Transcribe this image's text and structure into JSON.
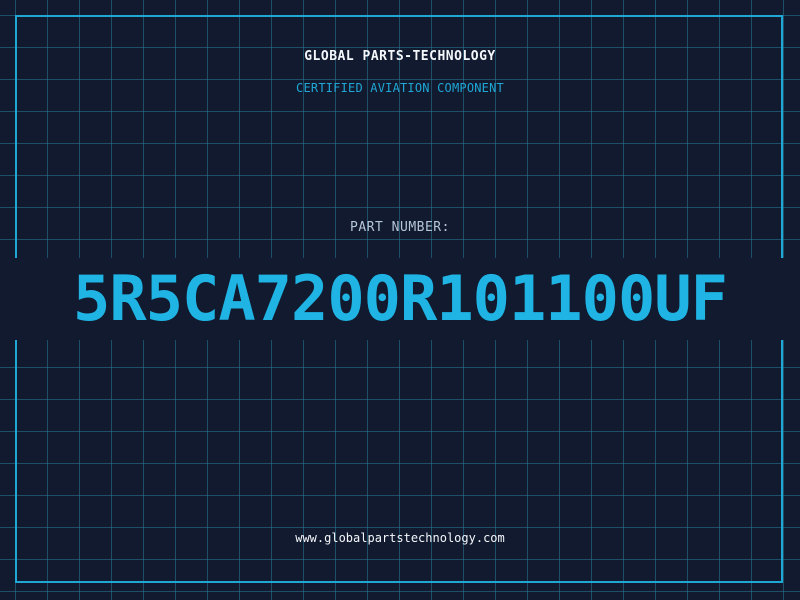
{
  "header": {
    "company": "GLOBAL PARTS-TECHNOLOGY",
    "subtitle": "CERTIFIED AVIATION COMPONENT"
  },
  "part": {
    "label": "PART NUMBER:",
    "number": "5R5CA7200R101100UF"
  },
  "footer": {
    "website": "www.globalpartstechnology.com"
  },
  "colors": {
    "background": "#111a2e",
    "accent": "#1fa7d6",
    "text": "#f4f7fb"
  }
}
